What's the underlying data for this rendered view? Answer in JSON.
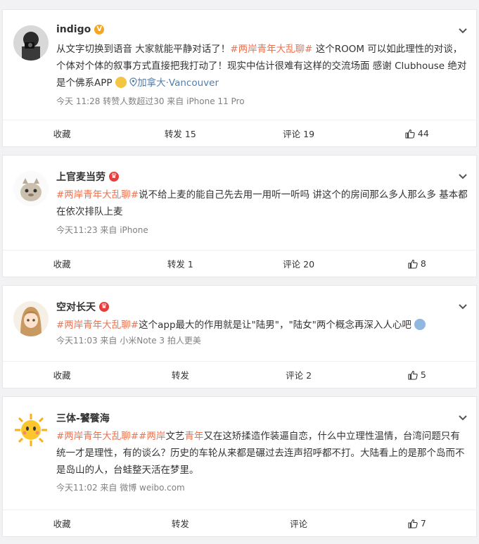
{
  "posts": [
    {
      "username": "indigo",
      "content": {
        "p1": "从文字切换到语音 大家就能平静对话了！",
        "topic": "#两岸青年大乱聊#",
        "p2": " 这个ROOM 可以如此理性的对谈，个体对个体的叙事方式直接把我打动了！现实中估计很难有这样的交流场面 感谢 Clubhouse 绝对是个佛系APP ",
        "location": "加拿大·Vancouver"
      },
      "meta": "今天 11:28 转赞人数超过30  来自 iPhone 11 Pro",
      "actions": {
        "fav": "收藏",
        "repost": "转发 15",
        "comment": "评论 19",
        "like": "44"
      }
    },
    {
      "username": "上官麦当劳",
      "content": {
        "topic": "#两岸青年大乱聊#",
        "p1": "说不给上麦的能自己先去用一用听一听吗 讲这个的房间那么多人那么多 基本都在依次排队上麦"
      },
      "meta": "今天11:23  来自 iPhone",
      "actions": {
        "fav": "收藏",
        "repost": "转发 1",
        "comment": "评论 20",
        "like": "8"
      }
    },
    {
      "username": "空对长天",
      "content": {
        "topic": "#两岸青年大乱聊#",
        "p1": "这个app最大的作用就是让\"陆男\"，\"陆女\"两个概念再深入人心吧"
      },
      "meta": "今天11:03  来自 小米Note 3 拍人更美",
      "actions": {
        "fav": "收藏",
        "repost": "转发",
        "comment": "评论 2",
        "like": "5"
      }
    },
    {
      "username": "三体-饕餮海",
      "content": {
        "topic": "#两岸青年大乱聊#",
        "topic2a": "#两岸",
        "mid": "文艺",
        "topic2b": "青年",
        "p1": "又在这矫揉造作装逼自恋，什么中立理性温情，台湾问题只有统一才是理性，有的谈么？历史的车轮从来都是碾过去连声招呼都不打。大陆看上的是那个岛而不是岛山的人，台蛙整天活在梦里。"
      },
      "meta": "今天11:02  来自 微博 weibo.com",
      "actions": {
        "fav": "收藏",
        "repost": "转发",
        "comment": "评论",
        "like": "7"
      }
    }
  ]
}
